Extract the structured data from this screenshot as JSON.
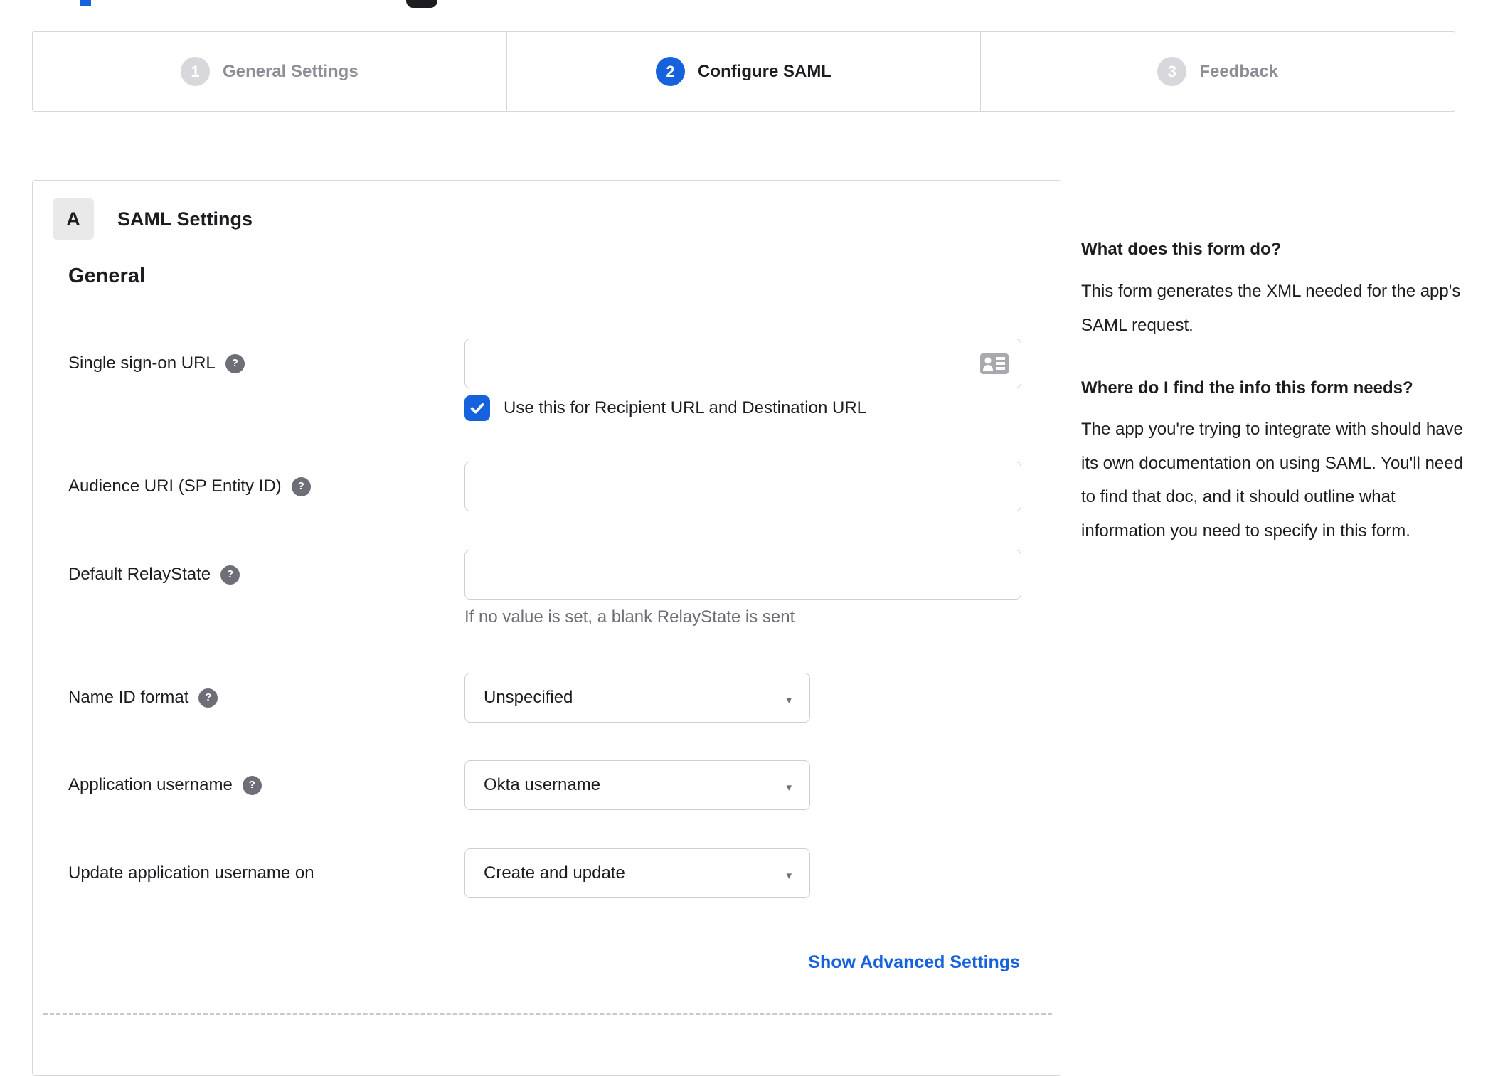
{
  "stepper": {
    "steps": [
      {
        "number": "1",
        "label": "General Settings",
        "active": false
      },
      {
        "number": "2",
        "label": "Configure SAML",
        "active": true
      },
      {
        "number": "3",
        "label": "Feedback",
        "active": false
      }
    ]
  },
  "panel": {
    "badge": "A",
    "title": "SAML Settings",
    "section_title": "General",
    "fields": {
      "sso": {
        "label": "Single sign-on URL",
        "value": "",
        "checkbox_label": "Use this for Recipient URL and Destination URL",
        "checked": true
      },
      "audience": {
        "label": "Audience URI (SP Entity ID)",
        "value": ""
      },
      "relay": {
        "label": "Default RelayState",
        "value": "",
        "helper": "If no value is set, a blank RelayState is sent"
      },
      "nameid": {
        "label": "Name ID format",
        "value": "Unspecified"
      },
      "appuser": {
        "label": "Application username",
        "value": "Okta username"
      },
      "updateuser": {
        "label": "Update application username on",
        "value": "Create and update"
      }
    },
    "advanced_link": "Show Advanced Settings"
  },
  "sidebar": {
    "heading1": "What does this form do?",
    "para1": "This form generates the XML needed for the app's SAML request.",
    "heading2": "Where do I find the info this form needs?",
    "para2": "The app you're trying to integrate with should have its own documentation on using SAML. You'll need to find that doc, and it should outline what information you need to specify in this form."
  },
  "colors": {
    "accent": "#1662dd",
    "text": "#1d1d21",
    "muted_label": "#8d8d95",
    "border": "#d7d7dc",
    "helper_text": "#6e6e78"
  }
}
